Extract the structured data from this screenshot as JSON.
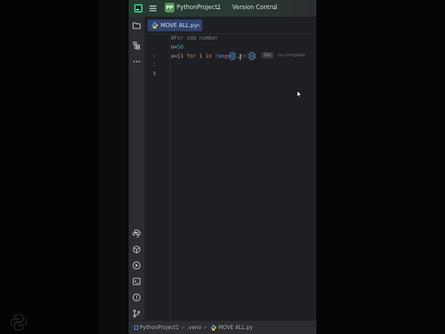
{
  "titlebar": {
    "project_badge": "PP",
    "project_name": "PythonProject1",
    "vcs_label": "Version Control"
  },
  "icons": {
    "app_logo": "jetbrains-logo-icon",
    "main_menu": "hamburger-menu-icon",
    "left_toolbar_top": [
      "folder-icon",
      "structure-icon",
      "more-icon"
    ],
    "left_toolbar_bottom": [
      "python-console-icon",
      "python-packages-icon",
      "services-icon",
      "terminal-icon",
      "problems-icon",
      "git-icon"
    ]
  },
  "tab": {
    "label": "MOVE ALL.py",
    "close": "×"
  },
  "editor": {
    "line_numbers": [
      "1",
      "2",
      "3"
    ],
    "line1": {
      "comment": "#For odd number"
    },
    "line2": {
      "var": "n",
      "eq": "=",
      "num": "50"
    },
    "line3": {
      "prefix": "x=[",
      "var1": "i ",
      "kw_for": "for",
      "var2": " i ",
      "kw_in": "in",
      "space": " ",
      "builtin": "range",
      "open_paren": "(",
      "num1": "1",
      "comma": ",",
      "ghost_n": "n",
      "ghost_rest": "+1",
      "close_paren": ")",
      "close_bracket": "]"
    },
    "completion_hint": {
      "key": "Tab",
      "text": "to complete"
    }
  },
  "statusbar": {
    "project": "PythonProject1",
    "sep": ">",
    "folder": ".venv",
    "file": "MOVE ALL.py"
  },
  "colors": {
    "accent_tab": "#2e436e",
    "project_badge": "#57965c",
    "keyword": "#cf8e6d",
    "number": "#2aacb8",
    "builtin": "#8888c6"
  }
}
